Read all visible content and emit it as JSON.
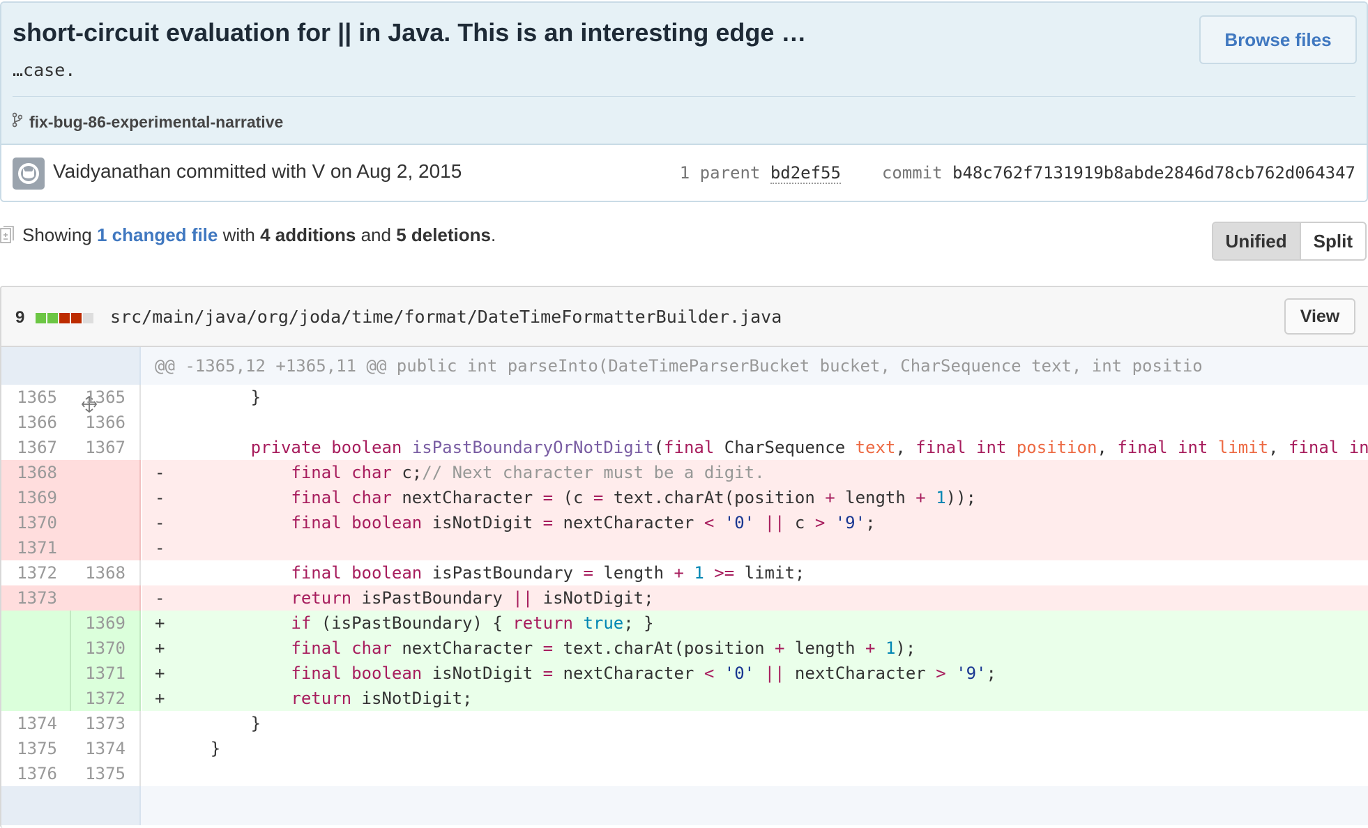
{
  "commit": {
    "title": "short-circuit evaluation for || in Java. This is an interesting edge …",
    "description": "…case.",
    "browse_files_label": "Browse files",
    "branch": "fix-bug-86-experimental-narrative",
    "author_line": "Vaidyanathan committed with V on Aug 2, 2015",
    "parent_label": "1 parent",
    "parent_sha": "bd2ef55",
    "commit_label": "commit",
    "commit_sha": "b48c762f7131919b8abde2846d78cb762d064347"
  },
  "toc": {
    "showing": "Showing",
    "changed_files": "1 changed file",
    "with": "with",
    "additions": "4 additions",
    "and": "and",
    "deletions": "5 deletions",
    "period": "."
  },
  "view_mode": {
    "unified_label": "Unified",
    "split_label": "Split",
    "selected": "Unified"
  },
  "file": {
    "changes_count": "9",
    "diffstat_blocks": [
      "add",
      "add",
      "del",
      "del",
      "neutral"
    ],
    "path": "src/main/java/org/joda/time/format/DateTimeFormatterBuilder.java",
    "view_label": "View",
    "hunk_header": "@@ -1365,12 +1365,11 @@ public int parseInto(DateTimeParserBucket bucket, CharSequence text, int positio",
    "lines": [
      {
        "type": "ctx",
        "old": "1365",
        "new": "1365",
        "sign": " ",
        "code": "        }"
      },
      {
        "type": "ctx",
        "old": "1366",
        "new": "1366",
        "sign": " ",
        "code": ""
      },
      {
        "type": "ctx",
        "old": "1367",
        "new": "1367",
        "sign": " ",
        "code": "        private boolean isPastBoundaryOrNotDigit(final CharSequence text, final int position, final int limit, final int"
      },
      {
        "type": "del",
        "old": "1368",
        "new": "",
        "sign": "-",
        "code": "            final char c;// Next character must be a digit."
      },
      {
        "type": "del",
        "old": "1369",
        "new": "",
        "sign": "-",
        "code": "            final char nextCharacter = (c = text.charAt(position + length + 1));"
      },
      {
        "type": "del",
        "old": "1370",
        "new": "",
        "sign": "-",
        "code": "            final boolean isNotDigit = nextCharacter < '0' || c > '9';"
      },
      {
        "type": "del",
        "old": "1371",
        "new": "",
        "sign": "-",
        "code": ""
      },
      {
        "type": "ctx",
        "old": "1372",
        "new": "1368",
        "sign": " ",
        "code": "            final boolean isPastBoundary = length + 1 >= limit;"
      },
      {
        "type": "del",
        "old": "1373",
        "new": "",
        "sign": "-",
        "code": "            return isPastBoundary || isNotDigit;"
      },
      {
        "type": "add",
        "old": "",
        "new": "1369",
        "sign": "+",
        "code": "            if (isPastBoundary) { return true; }"
      },
      {
        "type": "add",
        "old": "",
        "new": "1370",
        "sign": "+",
        "code": "            final char nextCharacter = text.charAt(position + length + 1);"
      },
      {
        "type": "add",
        "old": "",
        "new": "1371",
        "sign": "+",
        "code": "            final boolean isNotDigit = nextCharacter < '0' || nextCharacter > '9';"
      },
      {
        "type": "add",
        "old": "",
        "new": "1372",
        "sign": "+",
        "code": "            return isNotDigit;"
      },
      {
        "type": "ctx",
        "old": "1374",
        "new": "1373",
        "sign": " ",
        "code": "        }"
      },
      {
        "type": "ctx",
        "old": "1375",
        "new": "1374",
        "sign": " ",
        "code": "    }"
      },
      {
        "type": "ctx",
        "old": "1376",
        "new": "1375",
        "sign": " ",
        "code": ""
      }
    ]
  },
  "colors": {
    "accent": "#4078c0",
    "addition": "#6cc644",
    "deletion": "#bd2c00",
    "neutral": "#dddddd"
  }
}
